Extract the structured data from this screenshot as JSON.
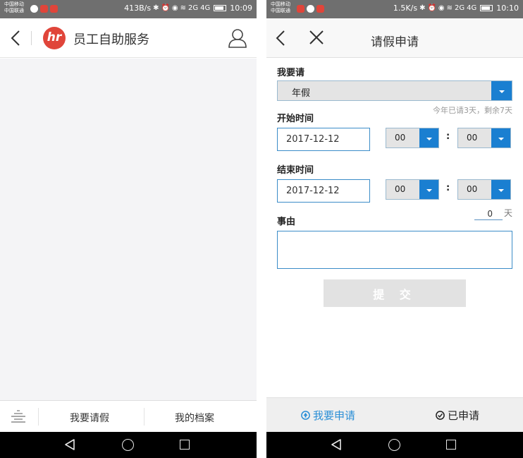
{
  "left_screen": {
    "status": {
      "carrier_1": "中国移动",
      "carrier_2": "中国联通",
      "speed": "413B/s",
      "signal_1": "2G",
      "signal_2": "4G",
      "time": "10:09"
    },
    "header": {
      "logo_text": "hr",
      "title": "员工自助服务"
    },
    "tabs": {
      "leave": "我要请假",
      "profile": "我的档案"
    }
  },
  "right_screen": {
    "status": {
      "carrier_1": "中国移动",
      "carrier_2": "中国联通",
      "speed": "1.5K/s",
      "signal_1": "2G",
      "signal_2": "4G",
      "time": "10:10"
    },
    "header": {
      "title": "请假申请"
    },
    "form": {
      "type_label": "我要请",
      "leave_type": "年假",
      "quota_hint": "今年已请3天，剩余7天",
      "start_label": "开始时间",
      "start_date": "2017-12-12",
      "start_hour": "00",
      "start_minute": "00",
      "colon": ":",
      "end_label": "结束时间",
      "end_date": "2017-12-12",
      "end_hour": "00",
      "end_minute": "00",
      "days_value": "0",
      "days_unit": "天",
      "reason_label": "事由",
      "reason_value": "",
      "submit": "提 交"
    },
    "tabs": {
      "apply": "我要申请",
      "applied": "已申请"
    }
  },
  "colors": {
    "accent_blue": "#1a7fd1",
    "tab_active": "#2b8fd6",
    "brand_red": "#e0453a",
    "status_bar": "#6f6f6f"
  }
}
